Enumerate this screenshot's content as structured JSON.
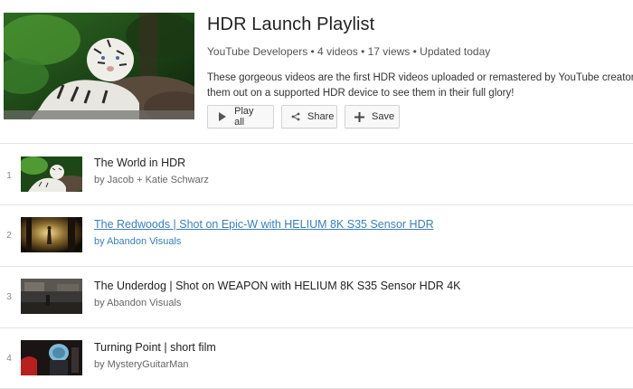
{
  "playlist": {
    "title": "HDR Launch Playlist",
    "meta": "YouTube Developers • 4 videos • 17 views • Updated today",
    "description_line1": "These gorgeous videos are the first HDR videos uploaded or remastered by YouTube creators.",
    "description_line2": "them out on a supported HDR device to see them in their full glory!"
  },
  "actions": {
    "play_all": "Play all",
    "share": "Share",
    "save": "Save"
  },
  "videos": [
    {
      "index": "1",
      "title": "The World in HDR",
      "author": "by Jacob + Katie Schwarz"
    },
    {
      "index": "2",
      "title": "The Redwoods | Shot on Epic-W with HELIUM 8K S35 Sensor HDR",
      "author": "by Abandon Visuals"
    },
    {
      "index": "3",
      "title": "The Underdog | Shot on WEAPON with HELIUM 8K S35 Sensor HDR 4K",
      "author": "by Abandon Visuals"
    },
    {
      "index": "4",
      "title": "Turning Point | short film",
      "author": "by MysteryGuitarMan"
    }
  ],
  "colors": {
    "link": "#3b7fb6",
    "separator": "#e2e2e2"
  }
}
